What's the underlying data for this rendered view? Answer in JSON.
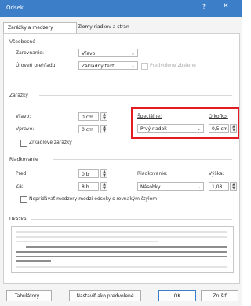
{
  "window": {
    "title": "Odsek",
    "help_label": "?",
    "close_label": "✕"
  },
  "tabs": [
    {
      "label": "Zarážky a medzery",
      "active": true
    },
    {
      "label": "Zlomy riadkov a strán",
      "active": false
    }
  ],
  "general": {
    "section_label": "Všeobecné",
    "alignment_label": "Zarovnanie:",
    "alignment_value": "Vľavo",
    "outline_label": "Úroveň prehľadu:",
    "outline_value": "Základný text",
    "collapsed_label": "Predvolene zbalené"
  },
  "indents": {
    "section_label": "Zarážky",
    "left_label": "Vľavo:",
    "left_value": "0 cm",
    "right_label": "Vpravo:",
    "right_value": "0 cm",
    "special_label": "Špeciálne:",
    "special_value": "Prvý riadok",
    "by_label": "O koľko:",
    "by_value": "0,5 cm",
    "mirror_label": "Zrkadlové zarážky"
  },
  "spacing": {
    "section_label": "Riadkovanie",
    "before_label": "Pred:",
    "before_value": "0 b",
    "after_label": "Za:",
    "after_value": "8 b",
    "line_spacing_label": "Riadkovanie:",
    "line_spacing_value": "Násobky",
    "at_label": "Výška:",
    "at_value": "1,08",
    "dont_add_label": "Nepridávať medzery medzi odseky s rovnakým štýlom"
  },
  "preview": {
    "section_label": "Ukážka"
  },
  "buttons": {
    "tabs": "Tabulátory...",
    "default": "Nastaviť ako predvolené",
    "ok": "OK",
    "cancel": "Zrušiť"
  },
  "colors": {
    "titlebar": "#3c7fc8",
    "highlight": "#e31b23"
  },
  "icons": {
    "spin_up": "▲",
    "spin_down": "▼",
    "dropdown": "⌄"
  }
}
